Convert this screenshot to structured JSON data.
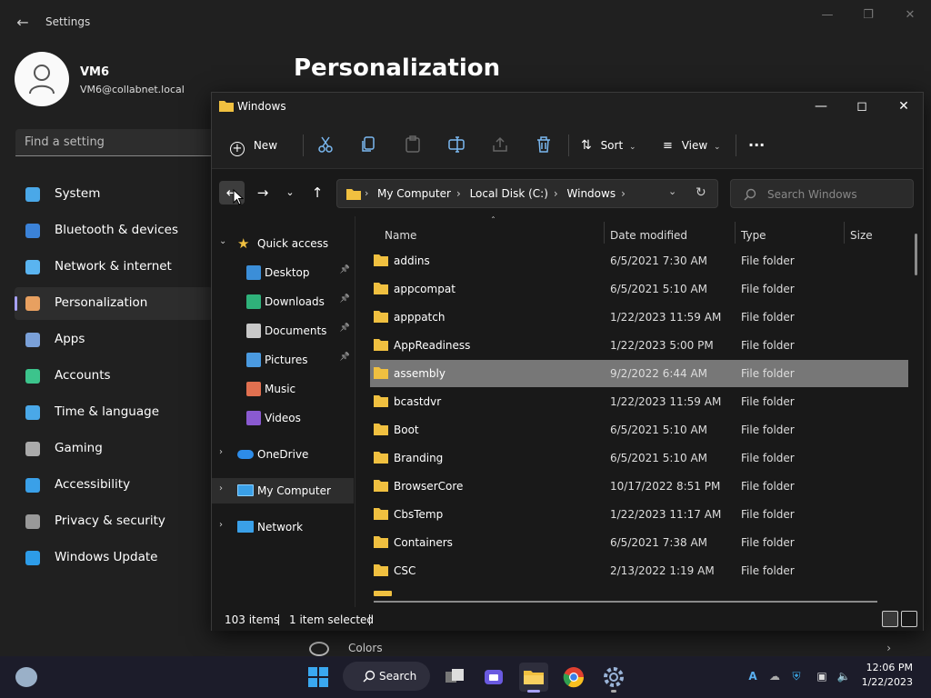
{
  "settings": {
    "title": "Settings",
    "user_name": "VM6",
    "user_email": "VM6@collabnet.local",
    "search_placeholder": "Find a setting",
    "page_title": "Personalization",
    "nav": [
      {
        "label": "System",
        "color": "#4aa8e8"
      },
      {
        "label": "Bluetooth & devices",
        "color": "#3b82d8"
      },
      {
        "label": "Network & internet",
        "color": "#5ab4f0"
      },
      {
        "label": "Personalization",
        "color": "#e8a060"
      },
      {
        "label": "Apps",
        "color": "#7aa0d8"
      },
      {
        "label": "Accounts",
        "color": "#3cc48c"
      },
      {
        "label": "Time & language",
        "color": "#4aa8e8"
      },
      {
        "label": "Gaming",
        "color": "#aaaaaa"
      },
      {
        "label": "Accessibility",
        "color": "#3aa0e8"
      },
      {
        "label": "Privacy & security",
        "color": "#999999"
      },
      {
        "label": "Windows Update",
        "color": "#2d9ce8"
      }
    ],
    "active_nav": "Personalization",
    "colors_label": "Colors"
  },
  "explorer": {
    "title": "Windows",
    "toolbar": {
      "new_label": "New",
      "sort_label": "Sort",
      "view_label": "View",
      "more_label": "···"
    },
    "breadcrumb": [
      "My Computer",
      "Local Disk (C:)",
      "Windows"
    ],
    "search_placeholder": "Search Windows",
    "nav_pane": {
      "quick_access": "Quick access",
      "pinned": [
        {
          "label": "Desktop",
          "icon": "desktop-icon",
          "color": "#3b8ed8"
        },
        {
          "label": "Downloads",
          "icon": "downloads-icon",
          "color": "#2fb27a"
        },
        {
          "label": "Documents",
          "icon": "documents-icon",
          "color": "#c8c8c8"
        },
        {
          "label": "Pictures",
          "icon": "pictures-icon",
          "color": "#4a9ae0"
        }
      ],
      "unpinned": [
        {
          "label": "Music",
          "icon": "music-icon",
          "color": "#e07050"
        },
        {
          "label": "Videos",
          "icon": "videos-icon",
          "color": "#8a5ad0"
        }
      ],
      "onedrive": "OneDrive",
      "my_computer": "My Computer",
      "network": "Network"
    },
    "columns": {
      "name": "Name",
      "date": "Date modified",
      "type": "Type",
      "size": "Size"
    },
    "files": [
      {
        "name": "addins",
        "date": "6/5/2021 7:30 AM",
        "type": "File folder"
      },
      {
        "name": "appcompat",
        "date": "6/5/2021 5:10 AM",
        "type": "File folder"
      },
      {
        "name": "apppatch",
        "date": "1/22/2023 11:59 AM",
        "type": "File folder"
      },
      {
        "name": "AppReadiness",
        "date": "1/22/2023 5:00 PM",
        "type": "File folder"
      },
      {
        "name": "assembly",
        "date": "9/2/2022 6:44 AM",
        "type": "File folder"
      },
      {
        "name": "bcastdvr",
        "date": "1/22/2023 11:59 AM",
        "type": "File folder"
      },
      {
        "name": "Boot",
        "date": "6/5/2021 5:10 AM",
        "type": "File folder"
      },
      {
        "name": "Branding",
        "date": "6/5/2021 5:10 AM",
        "type": "File folder"
      },
      {
        "name": "BrowserCore",
        "date": "10/17/2022 8:51 PM",
        "type": "File folder"
      },
      {
        "name": "CbsTemp",
        "date": "1/22/2023 11:17 AM",
        "type": "File folder"
      },
      {
        "name": "Containers",
        "date": "6/5/2021 7:38 AM",
        "type": "File folder"
      },
      {
        "name": "CSC",
        "date": "2/13/2022 1:19 AM",
        "type": "File folder"
      }
    ],
    "selected_file": "assembly",
    "status": {
      "count": "103 items",
      "selected": "1 item selected"
    }
  },
  "taskbar": {
    "search_label": "Search",
    "time": "12:06 PM",
    "date": "1/22/2023"
  }
}
